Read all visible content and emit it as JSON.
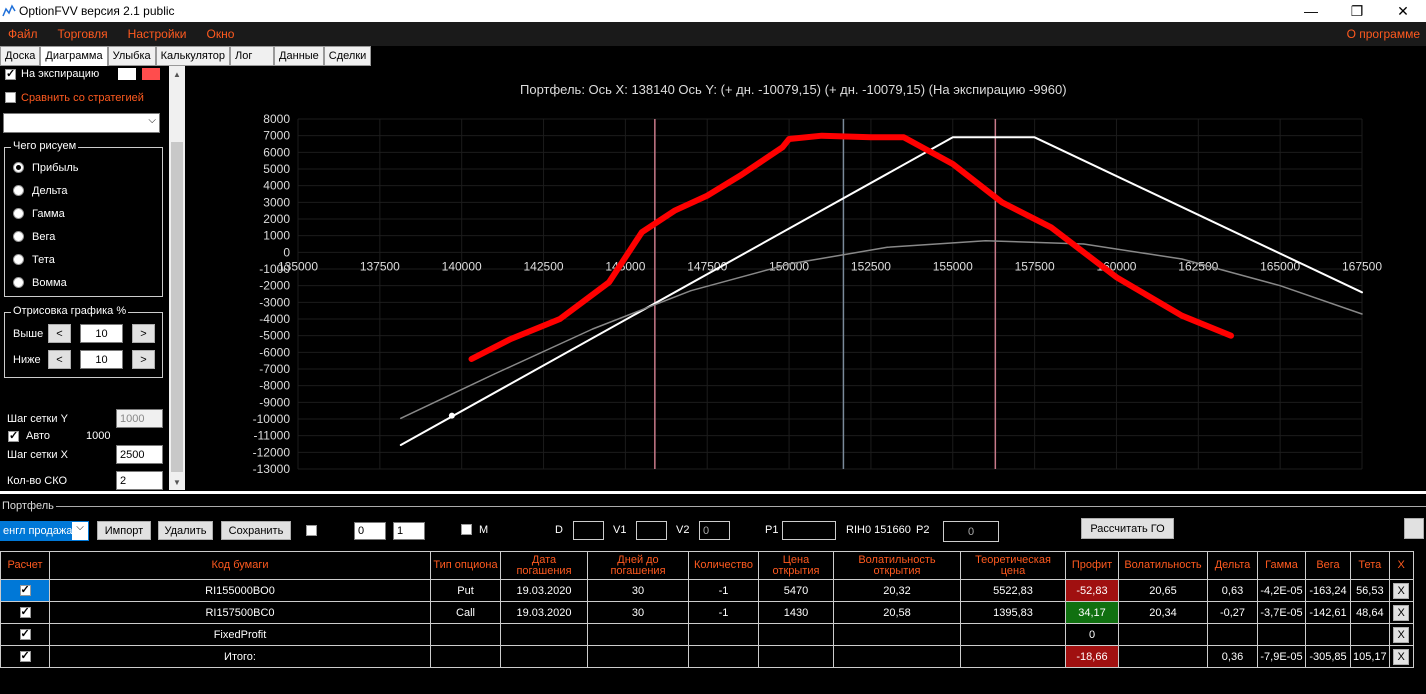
{
  "window": {
    "title": "OptionFVV версия 2.1 public",
    "minimize": "—",
    "restore": "❐",
    "close": "✕"
  },
  "menu": {
    "items": [
      "Файл",
      "Торговля",
      "Настройки",
      "Окно"
    ],
    "about": "О программе"
  },
  "tabs": [
    "Доска",
    "Диаграмма",
    "Улыбка",
    "Калькулятор",
    "Лог",
    "Данные",
    "Сделки"
  ],
  "left": {
    "expiry_label": "На экспирацию",
    "compare_label": "Сравнить со стратегией",
    "what_draw": {
      "legend": "Чего рисуем",
      "options": [
        "Прибыль",
        "Дельта",
        "Гамма",
        "Вега",
        "Тета",
        "Вомма"
      ],
      "selected": "Прибыль"
    },
    "draw_pct": {
      "legend": "Отрисовка графика %",
      "above_label": "Выше",
      "above_value": "10",
      "below_label": "Ниже",
      "below_value": "10",
      "dec": "<",
      "inc": ">"
    },
    "grid_y_label": "Шаг сетки Y",
    "grid_y_value": "1000",
    "auto_label": "Авто",
    "auto_value": "1000",
    "grid_x_label": "Шаг сетки X",
    "grid_x_value": "2500",
    "sko_label": "Кол-во СКО",
    "sko_value": "2"
  },
  "chart_data": {
    "type": "line",
    "title": "Портфель: Ось X: 138140 Ось Y:  (+ дн. -10079,15)  (+ дн. -10079,15)  (На экспирацию -9960)",
    "x_ticks": [
      "135000",
      "137500",
      "140000",
      "142500",
      "145000",
      "147500",
      "150000",
      "152500",
      "155000",
      "157500",
      "160000",
      "162500",
      "165000",
      "167500"
    ],
    "y_ticks": [
      "8000",
      "7000",
      "6000",
      "5000",
      "4000",
      "3000",
      "2000",
      "1000",
      "0",
      "-1000",
      "-2000",
      "-3000",
      "-4000",
      "-5000",
      "-6000",
      "-7000",
      "-8000",
      "-9000",
      "-10000",
      "-11000",
      "-12000",
      "-13000"
    ],
    "xlim": [
      135000,
      167500
    ],
    "ylim": [
      -13000,
      8000
    ],
    "vlines": [
      {
        "x": 145900,
        "color": "#c87a8a"
      },
      {
        "x": 151660,
        "color": "#7a8a9a"
      },
      {
        "x": 156300,
        "color": "#c87a8a"
      }
    ],
    "series": [
      {
        "color": "#ffffff",
        "x": [
          138140,
          155000,
          157500,
          167500
        ],
        "y": [
          -11560,
          6900,
          6900,
          -2400
        ]
      },
      {
        "color": "#888888",
        "x": [
          138140,
          141000,
          144000,
          147000,
          150000,
          153000,
          156000,
          159000,
          162000,
          165000,
          167500
        ],
        "y": [
          -9960,
          -7300,
          -4600,
          -2300,
          -700,
          300,
          700,
          500,
          -400,
          -2000,
          -3700
        ]
      },
      {
        "color": "#ff0000",
        "x": [
          140300,
          141500,
          143000,
          144500,
          145500,
          146500,
          147500,
          148500,
          149800,
          150000,
          151000,
          152500,
          153500,
          155000,
          156500,
          158000,
          160000,
          162000,
          163500
        ],
        "y": [
          -6400,
          -5200,
          -4000,
          -1800,
          1200,
          2500,
          3400,
          4600,
          6300,
          6800,
          7000,
          6900,
          6900,
          5300,
          3000,
          1500,
          -1500,
          -3800,
          -5000
        ]
      }
    ]
  },
  "portfolio": {
    "label": "Портфель",
    "strategy_value": "енгл продажа",
    "import": "Импорт",
    "delete": "Удалить",
    "save": "Сохранить",
    "spin1": "0",
    "spin2": "1",
    "m_label": "M",
    "d_label": "D",
    "v1_label": "V1",
    "v2_label": "V2",
    "v2_value": "0",
    "p1_label": "P1",
    "ticker_label": "RIH0 151660",
    "p2_label": "P2",
    "p2_value": "0",
    "calc_go": "Рассчитать ГО",
    "columns": [
      "Расчет",
      "Код бумаги",
      "Тип опциона",
      "Дата погашения",
      "Дней до погашения",
      "Количество",
      "Цена открытия",
      "Волатильность открытия",
      "Теоретическая цена",
      "Профит",
      "Волатильность",
      "Дельта",
      "Гамма",
      "Вега",
      "Тета",
      "X"
    ],
    "rows": [
      {
        "code": "RI155000BO0",
        "type": "Put",
        "date": "19.03.2020",
        "days": "30",
        "qty": "-1",
        "price": "5470",
        "vol_open": "20,32",
        "theo": "5522,83",
        "profit": "-52,83",
        "vol": "20,65",
        "delta": "0,63",
        "gamma": "-4,2E-05",
        "vega": "-163,24",
        "theta": "56,53",
        "x": "X"
      },
      {
        "code": "RI157500BC0",
        "type": "Call",
        "date": "19.03.2020",
        "days": "30",
        "qty": "-1",
        "price": "1430",
        "vol_open": "20,58",
        "theo": "1395,83",
        "profit": "34,17",
        "vol": "20,34",
        "delta": "-0,27",
        "gamma": "-3,7E-05",
        "vega": "-142,61",
        "theta": "48,64",
        "x": "X"
      },
      {
        "code": "FixedProfit",
        "type": "",
        "date": "",
        "days": "",
        "qty": "",
        "price": "",
        "vol_open": "",
        "theo": "",
        "profit": "0",
        "vol": "",
        "delta": "",
        "gamma": "",
        "vega": "",
        "theta": "",
        "x": "X"
      },
      {
        "code": "Итого:",
        "type": "",
        "date": "",
        "days": "",
        "qty": "",
        "price": "",
        "vol_open": "",
        "theo": "",
        "profit": "-18,66",
        "vol": "",
        "delta": "0,36",
        "gamma": "-7,9E-05",
        "vega": "-305,85",
        "theta": "105,17",
        "x": "X"
      }
    ]
  }
}
